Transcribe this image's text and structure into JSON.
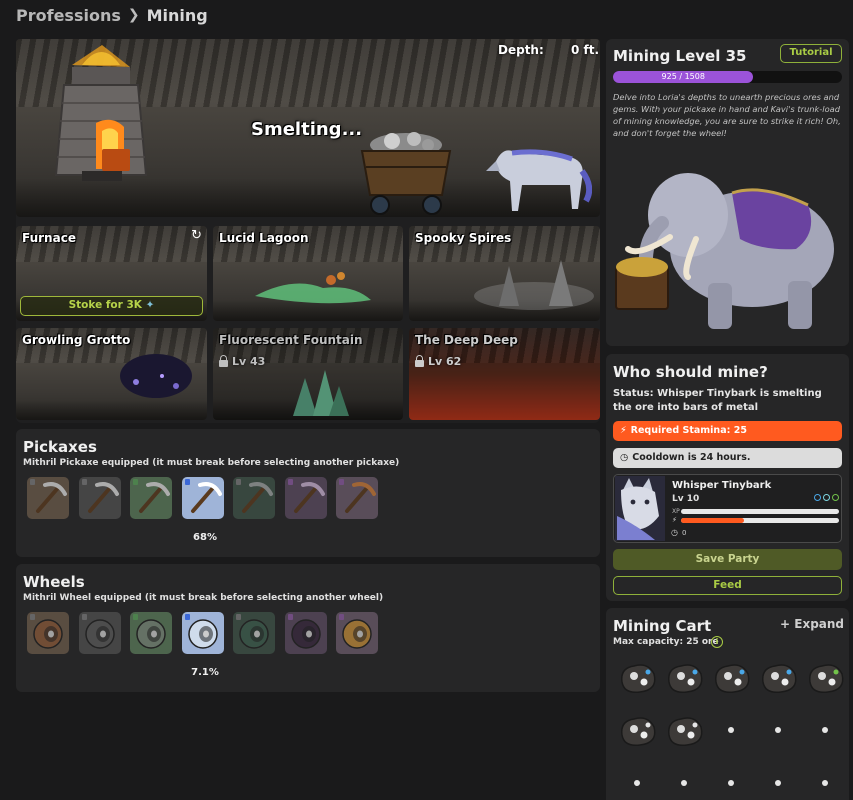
{
  "breadcrumb": {
    "root": "Professions",
    "current": "Mining"
  },
  "scene": {
    "depth_label": "Depth:",
    "depth_value": "0 ft.",
    "status": "Smelting..."
  },
  "locations": [
    {
      "name": "Furnace",
      "button": "Stoke for 3K"
    },
    {
      "name": "Lucid Lagoon"
    },
    {
      "name": "Spooky Spires"
    },
    {
      "name": "Growling Grotto"
    },
    {
      "name": "Fluorescent Fountain",
      "lock": "Lv 43"
    },
    {
      "name": "The Deep Deep",
      "lock": "Lv 62"
    }
  ],
  "pickaxes": {
    "title": "Pickaxes",
    "subtitle": "Mithril Pickaxe equipped (it must break before selecting another pickaxe)",
    "durability": "68%",
    "equipped_fraction": 0.68
  },
  "wheels": {
    "title": "Wheels",
    "subtitle": "Mithril Wheel equipped (it must break before selecting another wheel)",
    "durability": "7.1%",
    "equipped_fraction": 0.071
  },
  "level": {
    "title": "Mining Level 35",
    "tutorial": "Tutorial",
    "xp_text": "925 / 1508",
    "xp_current": 925,
    "xp_max": 1508,
    "description": "Delve into Loria's depths to unearth precious ores and gems. With your pickaxe in hand and Kavi's trunk-load of mining knowledge, you are sure to strike it rich! Oh, and don't forget the wheel!"
  },
  "mine": {
    "title": "Who should mine?",
    "status": "Status: Whisper Tinybark is smelting the ore into bars of metal",
    "stamina": "Required Stamina: 25",
    "cooldown": "Cooldown is 24 hours.",
    "pet_name": "Whisper Tinybark",
    "pet_level": "Lv 10",
    "xp_label": "XP",
    "stamina_count": "0",
    "stamina_fraction": 0.4,
    "save": "Save Party",
    "feed": "Feed"
  },
  "cart": {
    "title": "Mining Cart",
    "expand": "Expand",
    "capacity": "Max capacity: 25 ore"
  },
  "colors": {
    "accent": "#ff5a1f",
    "green": "#7ba33d",
    "purple": "#9b53d9",
    "olive": "#4f5a26"
  }
}
